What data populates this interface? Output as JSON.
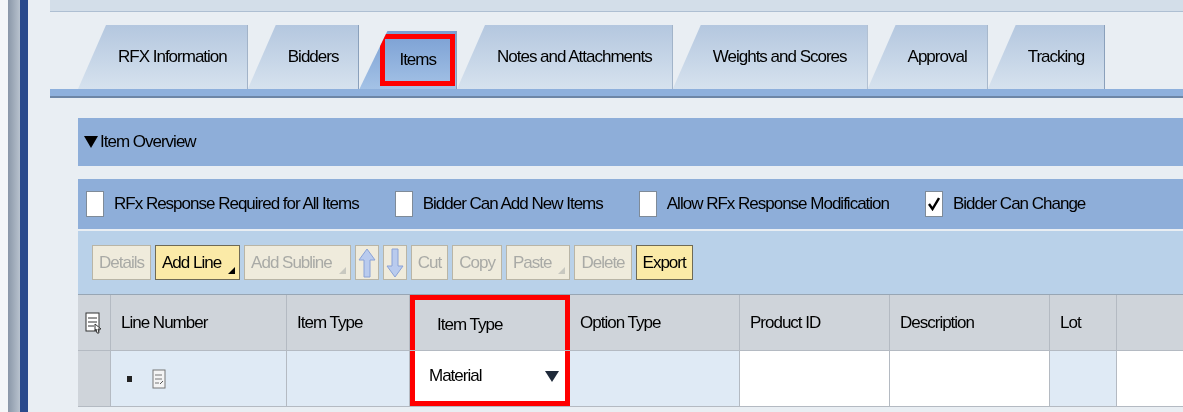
{
  "tabs": [
    {
      "label": "RFX Information",
      "selected": false,
      "highlighted": false
    },
    {
      "label": "Bidders",
      "selected": false,
      "highlighted": false
    },
    {
      "label": "Items",
      "selected": true,
      "highlighted": true
    },
    {
      "label": "Notes and Attachments",
      "selected": false,
      "highlighted": false
    },
    {
      "label": "Weights and Scores",
      "selected": false,
      "highlighted": false
    },
    {
      "label": "Approval",
      "selected": false,
      "highlighted": false
    },
    {
      "label": "Tracking",
      "selected": false,
      "highlighted": false
    }
  ],
  "section": {
    "title": "Item Overview",
    "expanded": true
  },
  "options": [
    {
      "label": "RFx Response Required for All Items",
      "checked": false
    },
    {
      "label": "Bidder Can Add New Items",
      "checked": false
    },
    {
      "label": "Allow RFx Response Modification",
      "checked": false
    },
    {
      "label": "Bidder Can Change",
      "checked": true
    }
  ],
  "toolbar": [
    {
      "kind": "button",
      "label": "Details",
      "disabled": true,
      "emphasized": false,
      "menu": false
    },
    {
      "kind": "button",
      "label": "Add Line",
      "disabled": false,
      "emphasized": true,
      "menu": true
    },
    {
      "kind": "button",
      "label": "Add Subline",
      "disabled": true,
      "emphasized": false,
      "menu": true
    },
    {
      "kind": "move_up",
      "disabled": true
    },
    {
      "kind": "move_down",
      "disabled": true
    },
    {
      "kind": "button",
      "label": "Cut",
      "disabled": true,
      "emphasized": false,
      "menu": false
    },
    {
      "kind": "button",
      "label": "Copy",
      "disabled": true,
      "emphasized": false,
      "menu": false
    },
    {
      "kind": "button",
      "label": "Paste",
      "disabled": true,
      "emphasized": false,
      "menu": true
    },
    {
      "kind": "button",
      "label": "Delete",
      "disabled": true,
      "emphasized": false,
      "menu": false
    },
    {
      "kind": "button",
      "label": "Export",
      "disabled": false,
      "emphasized": true,
      "menu": false
    }
  ],
  "table": {
    "columns": [
      {
        "label": "Line Number",
        "highlighted": false,
        "editable": false
      },
      {
        "label": "Item Type",
        "highlighted": false,
        "editable": false
      },
      {
        "label": "Item Type",
        "highlighted": true,
        "editable": true
      },
      {
        "label": "Option Type",
        "highlighted": false,
        "editable": false
      },
      {
        "label": "Product ID",
        "highlighted": false,
        "editable": true
      },
      {
        "label": "Description",
        "highlighted": false,
        "editable": true
      },
      {
        "label": "Lot",
        "highlighted": false,
        "editable": false
      }
    ],
    "rows": [
      {
        "cells": [
          {
            "kind": "line"
          },
          {
            "kind": "empty"
          },
          {
            "kind": "dropdown",
            "value": "Material"
          },
          {
            "kind": "empty"
          },
          {
            "kind": "empty"
          },
          {
            "kind": "empty"
          },
          {
            "kind": "empty"
          }
        ]
      }
    ]
  }
}
